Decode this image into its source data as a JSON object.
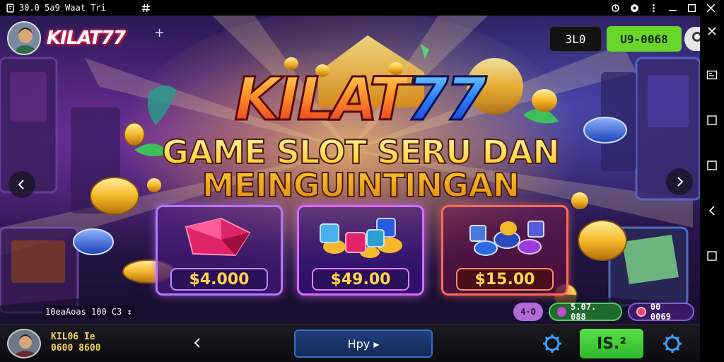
{
  "status_bar": {
    "time_text": "30.0 5a9 Waat Tri",
    "icons": [
      "notification-icon",
      "hash-icon",
      "sync-icon",
      "radio-icon",
      "more-icon",
      "minimize-icon",
      "maximize-icon",
      "close-icon"
    ]
  },
  "sys_nav": {
    "buttons": [
      "close-icon",
      "screenshot-icon",
      "square-icon",
      "square-icon",
      "back-icon",
      "square-icon"
    ]
  },
  "brand": {
    "name": "KILAT77",
    "plus_glyph": "+"
  },
  "balances": {
    "left_value": "3L0",
    "right_value": "U9-0068"
  },
  "headline": {
    "word": "KILAT",
    "number": "77",
    "tagline_line1": "GAME SLOT SERU DAN",
    "tagline_line2": "MEINGUINTINGAN"
  },
  "cards": [
    {
      "price": "$4.000"
    },
    {
      "price": "$49.00"
    },
    {
      "price": "$15.00"
    }
  ],
  "info_strip": {
    "text": "10eaAoas 100 C3 ↕"
  },
  "pills": {
    "a": "4·O",
    "b": "5.07. 088",
    "c": "00 0069"
  },
  "bottom_bar": {
    "user_name": "KIL06 Ie",
    "user_balance": "0600 8600",
    "play_label": "Hpy ▸",
    "green_label": "IS.²"
  },
  "colors": {
    "accent_green": "#6bd62a",
    "title_orange": "#ff5a1e",
    "title_blue": "#2a7dff",
    "gold": "#ffd24a"
  }
}
